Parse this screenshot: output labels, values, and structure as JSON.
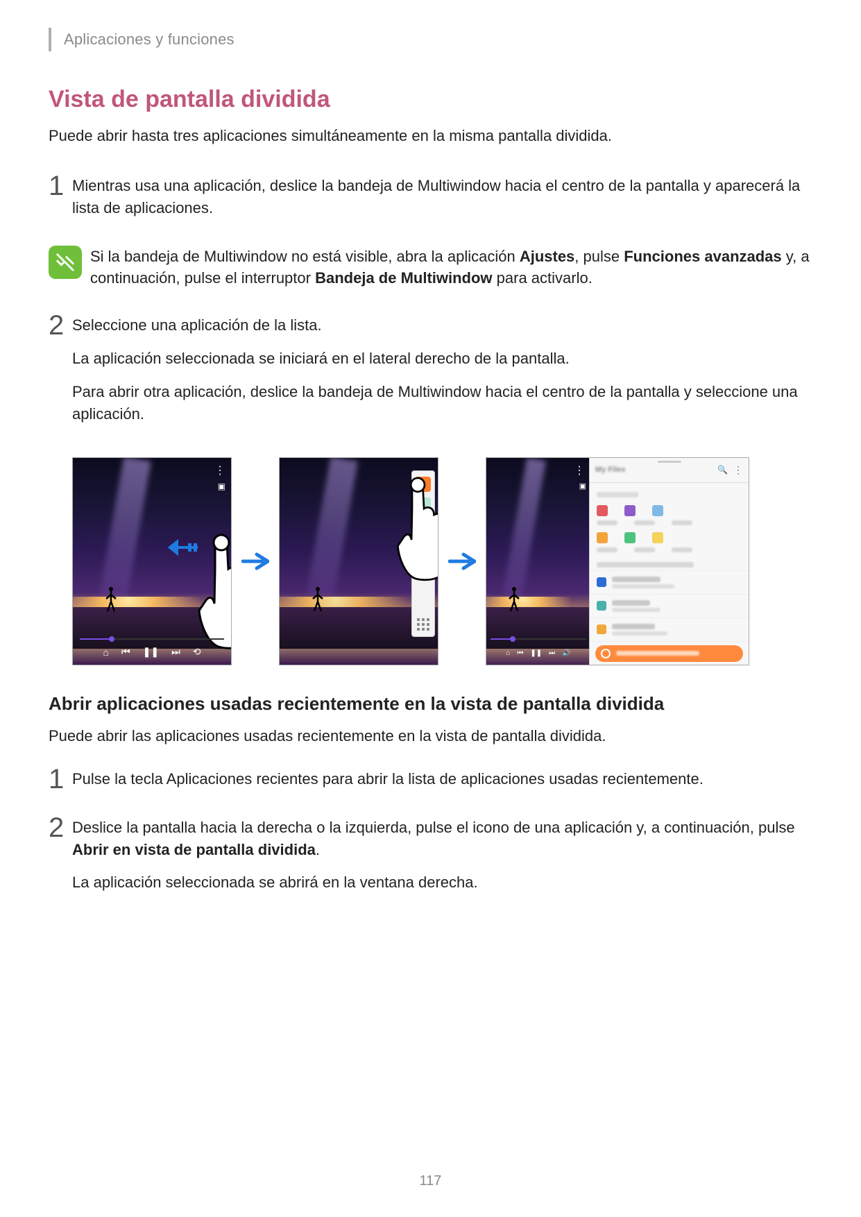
{
  "header": {
    "section": "Aplicaciones y funciones"
  },
  "title": "Vista de pantalla dividida",
  "intro": "Puede abrir hasta tres aplicaciones simultáneamente en la misma pantalla dividida.",
  "step1": {
    "num": "1",
    "text": "Mientras usa una aplicación, deslice la bandeja de Multiwindow hacia el centro de la pantalla y aparecerá la lista de aplicaciones."
  },
  "note": {
    "pre": "Si la bandeja de Multiwindow no está visible, abra la aplicación ",
    "b1": "Ajustes",
    "mid1": ", pulse ",
    "b2": "Funciones avanzadas",
    "mid2": " y, a continuación, pulse el interruptor ",
    "b3": "Bandeja de Multiwindow",
    "post": " para activarlo."
  },
  "step2": {
    "num": "2",
    "text": "Seleccione una aplicación de la lista.",
    "p1": "La aplicación seleccionada se iniciará en el lateral derecho de la pantalla.",
    "p2": "Para abrir otra aplicación, deslice la bandeja de Multiwindow hacia el centro de la pantalla y seleccione una aplicación."
  },
  "controls": {
    "prev": "⏮",
    "pause": "❚❚",
    "next": "⏭",
    "vol": "🔊",
    "lock": "⌂",
    "loop": "⟲"
  },
  "pane": {
    "title": "My Files",
    "search": "🔍",
    "more": "⋮",
    "topbar_sq": "▣",
    "categories": "Categories"
  },
  "sub": {
    "heading": "Abrir aplicaciones usadas recientemente en la vista de pantalla dividida",
    "intro": "Puede abrir las aplicaciones usadas recientemente en la vista de pantalla dividida."
  },
  "sub_step1": {
    "num": "1",
    "text": "Pulse la tecla Aplicaciones recientes para abrir la lista de aplicaciones usadas recientemente."
  },
  "sub_step2": {
    "num": "2",
    "pre": "Deslice la pantalla hacia la derecha o la izquierda, pulse el icono de una aplicación y, a continuación, pulse ",
    "b1": "Abrir en vista de pantalla dividida",
    "post": ".",
    "p1": "La aplicación seleccionada se abrirá en la ventana derecha."
  },
  "page_number": "117"
}
